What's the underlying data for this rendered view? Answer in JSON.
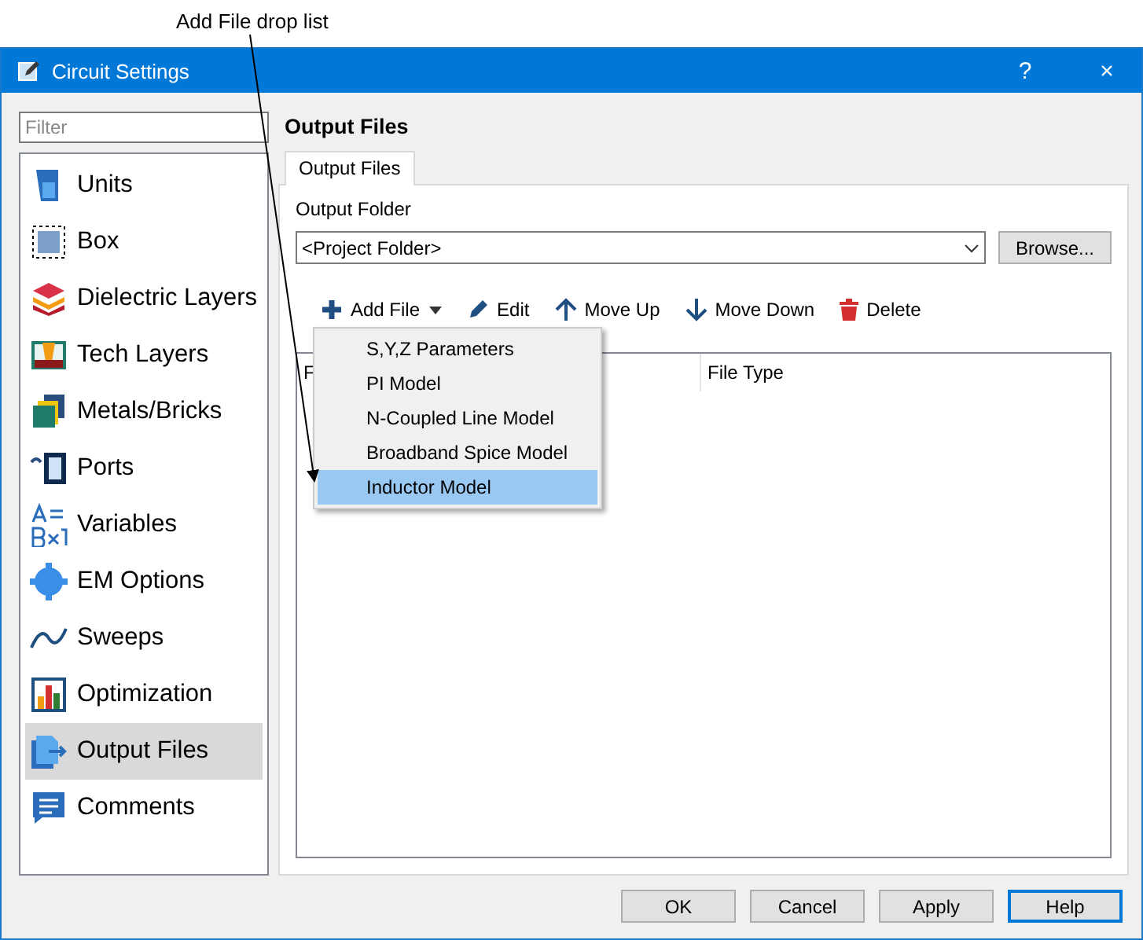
{
  "annotation": "Add File drop list",
  "window": {
    "title": "Circuit Settings",
    "help": "?",
    "close": "×"
  },
  "filter": {
    "placeholder": "Filter"
  },
  "sidebar": {
    "items": [
      {
        "label": "Units",
        "selected": false
      },
      {
        "label": "Box",
        "selected": false
      },
      {
        "label": "Dielectric Layers",
        "selected": false
      },
      {
        "label": "Tech Layers",
        "selected": false
      },
      {
        "label": "Metals/Bricks",
        "selected": false
      },
      {
        "label": "Ports",
        "selected": false
      },
      {
        "label": "Variables",
        "selected": false
      },
      {
        "label": "EM Options",
        "selected": false
      },
      {
        "label": "Sweeps",
        "selected": false
      },
      {
        "label": "Optimization",
        "selected": false
      },
      {
        "label": "Output Files",
        "selected": true
      },
      {
        "label": "Comments",
        "selected": false
      }
    ]
  },
  "heading": "Output Files",
  "tabs": [
    {
      "label": "Output Files",
      "selected": true
    }
  ],
  "output_folder": {
    "label": "Output Folder",
    "value": "<Project Folder>",
    "browse": "Browse..."
  },
  "toolbar": [
    {
      "kind": "add",
      "label": "Add File"
    },
    {
      "kind": "edit",
      "label": "Edit"
    },
    {
      "kind": "up",
      "label": "Move Up"
    },
    {
      "kind": "down",
      "label": "Move Down"
    },
    {
      "kind": "delete",
      "label": "Delete"
    }
  ],
  "menu": {
    "items": [
      {
        "label": "S,Y,Z Parameters",
        "selected": false
      },
      {
        "label": "PI Model",
        "selected": false
      },
      {
        "label": "N-Coupled Line Model",
        "selected": false
      },
      {
        "label": "Broadband Spice Model",
        "selected": false
      },
      {
        "label": "Inductor Model",
        "selected": true
      }
    ]
  },
  "table": {
    "columns": [
      "F",
      "File Type"
    ]
  },
  "buttons": [
    {
      "label": "OK",
      "focused": false
    },
    {
      "label": "Cancel",
      "focused": false
    },
    {
      "label": "Apply",
      "focused": false
    },
    {
      "label": "Help",
      "focused": true
    }
  ]
}
